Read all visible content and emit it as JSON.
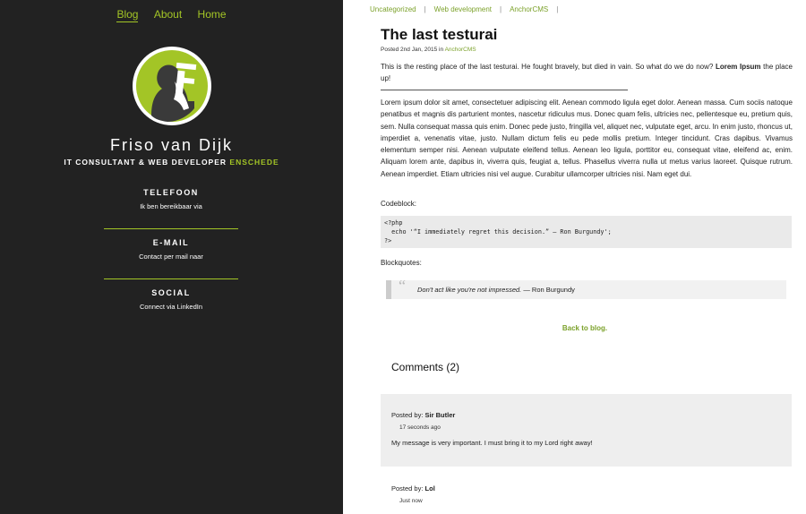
{
  "nav": {
    "items": [
      "Blog",
      "About",
      "Home"
    ],
    "active": "Blog"
  },
  "profile": {
    "name": "Friso van Dijk",
    "tagline_main": "IT CONSULTANT & WEB DEVELOPER",
    "tagline_city": "ENSCHEDE"
  },
  "contacts": [
    {
      "title": "TELEFOON",
      "sub": "Ik ben bereikbaar via"
    },
    {
      "title": "E-MAIL",
      "sub": "Contact per mail naar"
    },
    {
      "title": "SOCIAL",
      "sub": "Connect via LinkedIn"
    }
  ],
  "categories": [
    "Uncategorized",
    "Web development",
    "AnchorCMS"
  ],
  "post": {
    "title": "The last testurai",
    "posted_prefix": "Posted 2nd Jan, 2015 in",
    "category": "AnchorCMS",
    "intro": "This is the resting place of the last testurai. He fought bravely, but died in vain. So what do we do now?",
    "intro_bold": "Lorem Ipsum",
    "intro_end": "the place up!",
    "lorem": "Lorem ipsum dolor sit amet, consectetuer adipiscing elit. Aenean commodo ligula eget dolor. Aenean massa. Cum sociis natoque penatibus et magnis dis parturient montes, nascetur ridiculus mus. Donec quam felis, ultricies nec, pellentesque eu, pretium quis, sem. Nulla consequat massa quis enim. Donec pede justo, fringilla vel, aliquet nec, vulputate eget, arcu. In enim justo, rhoncus ut, imperdiet a, venenatis vitae, justo. Nullam dictum felis eu pede mollis pretium. Integer tincidunt. Cras dapibus. Vivamus elementum semper nisi. Aenean vulputate eleifend tellus. Aenean leo ligula, porttitor eu, consequat vitae, eleifend ac, enim. Aliquam lorem ante, dapibus in, viverra quis, feugiat a, tellus. Phasellus viverra nulla ut metus varius laoreet. Quisque rutrum. Aenean imperdiet. Etiam ultricies nisi vel augue. Curabitur ullamcorper ultricies nisi. Nam eget dui.",
    "codeblock_label": "Codeblock:",
    "code": "<?php\n  echo '“I immediately regret this decision.” — Ron Burgundy';\n?>",
    "blockquotes_label": "Blockquotes:",
    "quote_text": "Don't act like you're not impressed.",
    "quote_author": "— Ron Burgundy",
    "back_link": "Back to blog."
  },
  "comments": {
    "title": "Comments (2)",
    "posted_by_label": "Posted by:",
    "items": [
      {
        "author": "Sir Butler",
        "time": "17 seconds ago",
        "message": "My message is very important. I must bring it to my Lord right away!"
      },
      {
        "author": "Lol",
        "time": "Just now",
        "message": ""
      }
    ]
  },
  "colors": {
    "accent": "#a3c526",
    "sidebar_bg": "#222222",
    "comment_bg": "#eeeeee"
  }
}
